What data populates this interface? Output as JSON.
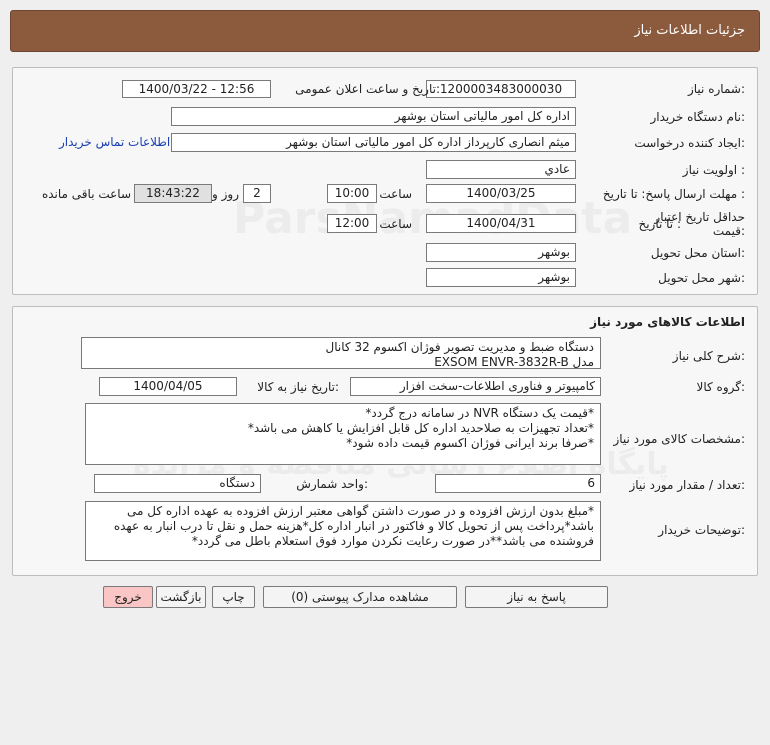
{
  "header": {
    "title": "جزئیات اطلاعات نیاز"
  },
  "details": {
    "need_number_label": "شماره نیاز:",
    "need_number": "1200003483000030",
    "announce_label": "تاریخ و ساعت اعلان عمومی:",
    "announce_value": "1400/03/22 - 12:56",
    "buyer_label": "نام دستگاه خریدار:",
    "buyer_value": "اداره کل امور مالياتی استان بوشهر",
    "requester_label": "ایجاد کننده درخواست:",
    "requester_value": "میثم انصاری کارپرداز اداره کل امور مالياتی استان بوشهر",
    "contact_link": "اطلاعات تماس خریدار",
    "priority_label": "اولویت نیاز :",
    "priority_value": "عادي",
    "deadline_label": "مهلت ارسال پاسخ:  تا تاریخ :",
    "deadline_date": "1400/03/25",
    "deadline_time_label": "ساعت",
    "deadline_time": "10:00",
    "days_value": "2",
    "days_label": "روز و",
    "remaining_value": "18:43:22",
    "remaining_label": "ساعت باقی مانده",
    "validity_label_line1": "حداقل تاریخ اعتبار",
    "validity_label_line2": "قیمت:",
    "validity_to_label": "تا تاریخ :",
    "validity_date": "1400/04/31",
    "validity_time_label": "ساعت",
    "validity_time": "12:00",
    "province_label": "استان محل تحویل:",
    "province_value": "بوشهر",
    "city_label": "شهر محل تحویل:",
    "city_value": "بوشهر"
  },
  "goods": {
    "section_title": "اطلاعات کالاهای مورد نیاز",
    "desc_label": "شرح کلی نیاز:",
    "desc_line1": "دستگاه ضبط و مدیریت تصویر فوژان اکسوم 32 کانال",
    "desc_line2": "مدل EXSOM ENVR-3832R-B",
    "group_label": "گروه کالا:",
    "group_value": "کامپیوتر و فناوری اطلاعات-سخت افزار",
    "need_date_label": "تاریخ نیاز به کالا:",
    "need_date_value": "1400/04/05",
    "specs_label": "مشخصات کالای مورد نیاز:",
    "specs_line1": "*قیمت یک دستگاه NVR در سامانه درج گردد*",
    "specs_line2": "*تعداد تجهیزات به صلاحدید اداره کل قابل افزایش یا کاهش می باشد*",
    "specs_line3": "*صرفا برند ایرانی فوژان اکسوم قیمت داده شود*",
    "qty_label": "تعداد / مقدار مورد نیاز:",
    "qty_value": "6",
    "unit_label": "واحد شمارش:",
    "unit_value": "دستگاه",
    "notes_label": "توضیحات خریدار:",
    "notes_text": "*مبلغ بدون ارزش افزوده و در صورت داشتن گواهی معتبر ارزش افزوده به عهده اداره کل می باشد*پرداخت پس از تحویل کالا و فاکتور در انبار اداره کل*هزینه حمل و نقل تا درب انبار به عهده فروشنده می باشد**در صورت رعایت نکردن موارد فوق استعلام باطل می گردد*"
  },
  "buttons": {
    "reply": "پاسخ به نیاز",
    "attachments": "مشاهده مدارک پیوستی (0)",
    "print": "چاپ",
    "back": "بازگشت",
    "exit": "خروج"
  }
}
